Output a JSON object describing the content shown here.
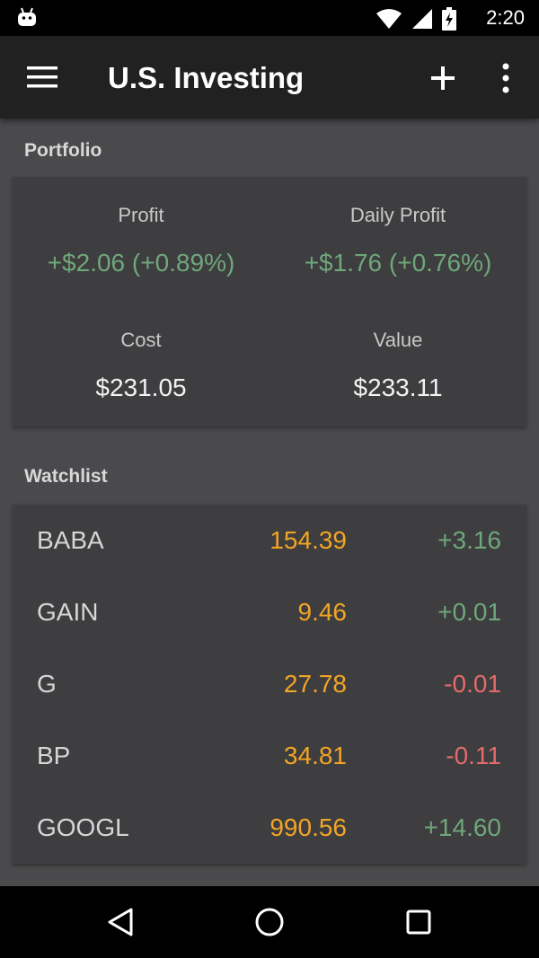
{
  "status_bar": {
    "time": "2:20",
    "icons": [
      "android-icon",
      "wifi-icon",
      "signal-icon",
      "battery-charging-icon"
    ]
  },
  "app_bar": {
    "title": "U.S. Investing",
    "icons": [
      "menu-icon",
      "add-icon",
      "more-vert-icon"
    ]
  },
  "portfolio": {
    "label": "Portfolio",
    "profit_label": "Profit",
    "profit_value": "+$2.06 (+0.89%)",
    "daily_profit_label": "Daily Profit",
    "daily_profit_value": "+$1.76 (+0.76%)",
    "cost_label": "Cost",
    "cost_value": "$231.05",
    "value_label": "Value",
    "value_value": "$233.11"
  },
  "watchlist": {
    "label": "Watchlist",
    "rows": [
      {
        "symbol": "BABA",
        "price": "154.39",
        "change": "+3.16",
        "direction": "up"
      },
      {
        "symbol": "GAIN",
        "price": "9.46",
        "change": "+0.01",
        "direction": "up"
      },
      {
        "symbol": "G",
        "price": "27.78",
        "change": "-0.01",
        "direction": "down"
      },
      {
        "symbol": "BP",
        "price": "34.81",
        "change": "-0.11",
        "direction": "down"
      },
      {
        "symbol": "GOOGL",
        "price": "990.56",
        "change": "+14.60",
        "direction": "up"
      }
    ]
  },
  "nav_bar": {
    "icons": [
      "back-icon",
      "home-icon",
      "recents-icon"
    ]
  },
  "colors": {
    "positive": "#6fa77b",
    "negative": "#e36b6b",
    "price": "#f2a526",
    "app_bar": "#212121",
    "card": "#3e3d3f",
    "background": "#4a494b"
  }
}
